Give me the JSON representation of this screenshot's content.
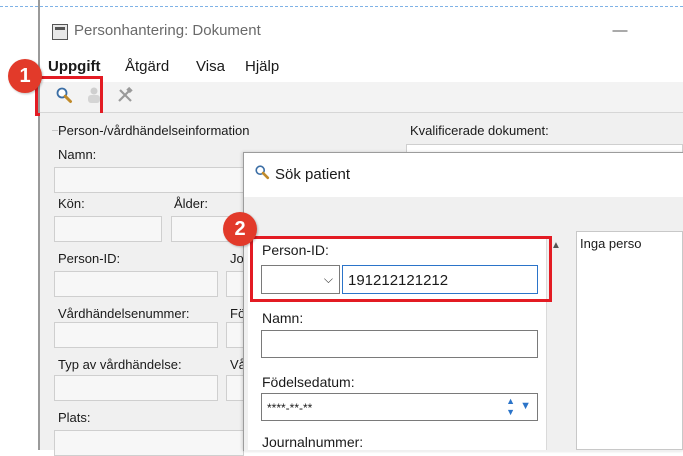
{
  "window": {
    "title": "Personhantering: Dokument"
  },
  "menu": {
    "items": [
      "Uppgift",
      "Åtgärd",
      "Visa",
      "Hjälp"
    ]
  },
  "toolbar": {
    "icons": [
      "search-icon",
      "person-icon",
      "tools-icon"
    ]
  },
  "badges": {
    "one": "1",
    "two": "2"
  },
  "panel": {
    "group_title": "Person-/vårdhändelseinformation",
    "name_label": "Namn:",
    "gender_label": "Kön:",
    "age_label": "Ålder:",
    "person_id_label": "Person-ID:",
    "cut_label_1": "Jo",
    "care_event_number_label": "Vårdhändelsenummer:",
    "cut_label_2": "Fö",
    "care_event_type_label": "Typ av vårdhändelse:",
    "cut_label_3": "Vå",
    "place_label": "Plats:"
  },
  "documents": {
    "label": "Kvalificerade dokument:"
  },
  "dialog": {
    "title": "Sök patient",
    "person_id_label": "Person-ID:",
    "person_id_value": "191212121212",
    "name_label": "Namn:",
    "name_value": "",
    "birthdate_label": "Födelsedatum:",
    "birthdate_value": "****-**-**",
    "journal_label": "Journalnummer:",
    "results_text": "Inga perso"
  },
  "colors": {
    "highlight": "#e31b23",
    "badge": "#e23a2a",
    "dashed_border": "#7fb2e6"
  }
}
